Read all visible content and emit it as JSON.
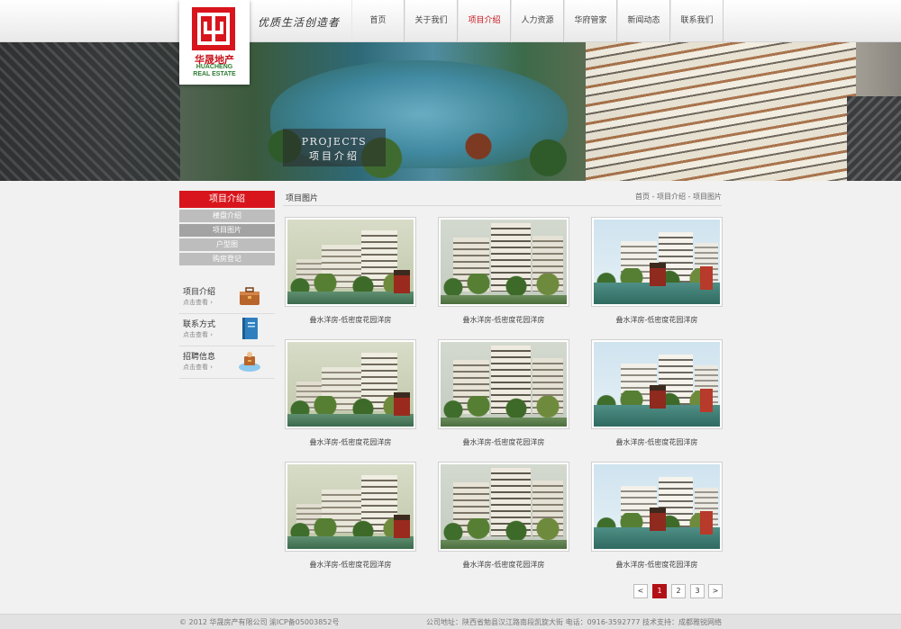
{
  "header": {
    "logo_cn": "华晟地产",
    "logo_en_1": "HUACHENG",
    "logo_en_2": "REAL ESTATE",
    "slogan": "优质生活创造者",
    "nav": [
      "首页",
      "关于我们",
      "项目介绍",
      "人力资源",
      "华府管家",
      "新闻动态",
      "联系我们"
    ],
    "nav_active": "项目介绍"
  },
  "banner": {
    "en": "PROJECTS",
    "cn": "项目介绍"
  },
  "sidebar": {
    "title": "项目介绍",
    "menu": [
      "楼盘介绍",
      "项目图片",
      "户型图",
      "购房登记"
    ],
    "menu_active": "项目图片",
    "cards": [
      {
        "title": "项目介绍",
        "more": "点击查看 ›",
        "icon": "briefcase-icon"
      },
      {
        "title": "联系方式",
        "more": "点击查看 ›",
        "icon": "book-icon"
      },
      {
        "title": "招聘信息",
        "more": "点击查看 ›",
        "icon": "recruit-icon"
      }
    ]
  },
  "main": {
    "title": "项目图片",
    "breadcrumb": "首页 - 项目介绍 - 项目图片",
    "items": [
      "叠水洋房-低密度花园洋房",
      "叠水洋房-低密度花园洋房",
      "叠水洋房-低密度花园洋房",
      "叠水洋房-低密度花园洋房",
      "叠水洋房-低密度花园洋房",
      "叠水洋房-低密度花园洋房",
      "叠水洋房-低密度花园洋房",
      "叠水洋房-低密度花园洋房",
      "叠水洋房-低密度花园洋房"
    ]
  },
  "pagination": {
    "prev": "<",
    "pages": [
      "1",
      "2",
      "3"
    ],
    "current": "1",
    "next": ">"
  },
  "footer": {
    "copyright": "© 2012 华晟房产有限公司 渝ICP备05003852号",
    "address": "公司地址：陕西省勉县汉江路南段凯旋大街  电话：0916-3592777  技术支持：成都雅锐网络"
  },
  "colors": {
    "brand_red": "#d8151c",
    "nav_active": "#c8141c"
  }
}
